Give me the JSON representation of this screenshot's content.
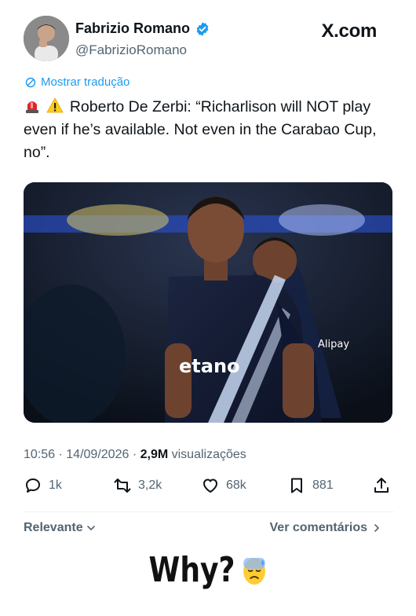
{
  "post": {
    "author_name": "Fabrizio Romano",
    "handle": "@FabrizioRomano",
    "brand": "X.com",
    "translate_label": "Mostrar tradução",
    "text": "Roberto De Zerbi: “Richarlison will NOT play even if he’s available. Not even in the Carabao Cup, no”.",
    "icons": [
      "siren-emoji",
      "warning-emoji"
    ],
    "media": {
      "jersey_text": "etano",
      "sponsor_text": "Alipay"
    }
  },
  "meta": {
    "time": "10:56",
    "date": "14/09/2026",
    "views_count": "2,9M",
    "views_label": "visualizações",
    "separator": "·"
  },
  "actions": {
    "replies": "1k",
    "reposts": "3,2k",
    "likes": "68k",
    "bookmarks": "881"
  },
  "footer": {
    "sort_label": "Relevante",
    "comments_link": "Ver comentários"
  },
  "caption": {
    "text": "Why?",
    "emoji": "sweat-emoji"
  },
  "colors": {
    "link_blue": "#1d9bf0",
    "muted": "#536471",
    "text": "#0f1419"
  }
}
